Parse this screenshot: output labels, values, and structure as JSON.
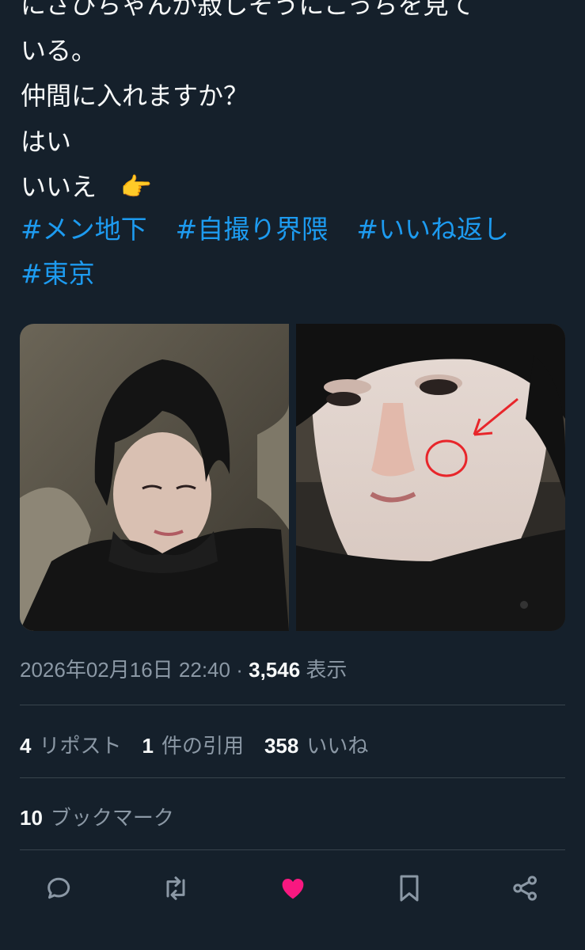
{
  "tweet": {
    "lines": [
      "にさひちゃんが寂しそうにこっちを見て",
      "いる。",
      "仲間に入れますか？",
      "はい",
      "いいえ"
    ],
    "pointer_emoji": "👉",
    "hashtags": [
      "#メン地下",
      "#自撮り界隈",
      "#いいね返し",
      "#東京"
    ]
  },
  "media": {
    "left_image": "selfie photo",
    "right_image": "close-up selfie photo with red circle and arrow annotation"
  },
  "meta": {
    "datetime": "2026年02月16日 22:40",
    "separator": "·",
    "views_count": "3,546",
    "views_label": "表示"
  },
  "stats": {
    "reposts_count": "4",
    "reposts_label": "リポスト",
    "quotes_count": "1",
    "quotes_label": "件の引用",
    "likes_count": "358",
    "likes_label": "いいね",
    "bookmarks_count": "10",
    "bookmarks_label": "ブックマーク"
  },
  "actions": [
    "reply-icon",
    "repost-icon",
    "like-icon",
    "bookmark-icon",
    "share-icon"
  ],
  "colors": {
    "background": "#15202b",
    "hashtag": "#1d9bf0",
    "muted": "#8b98a5",
    "like": "#f91880"
  }
}
